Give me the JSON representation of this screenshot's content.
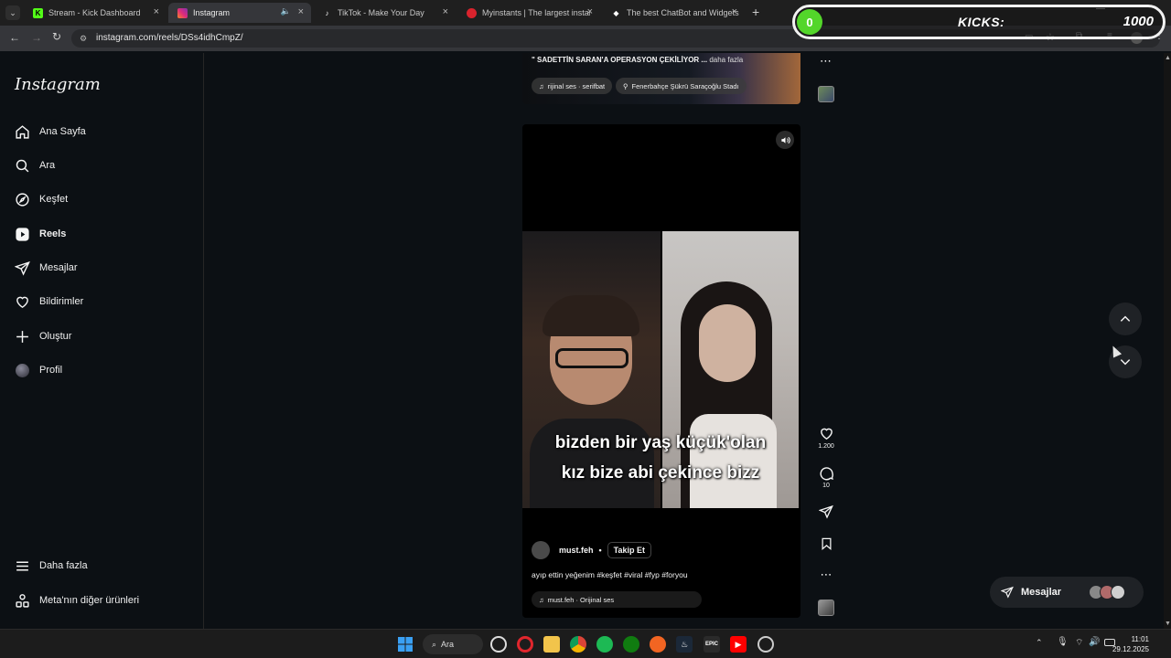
{
  "browser": {
    "tabs": [
      {
        "title": "Stream - Kick Dashboard",
        "icon": "kick-icon",
        "color": "#53fc18"
      },
      {
        "title": "Instagram",
        "icon": "instagram-icon",
        "color": "#e1306c",
        "active": true
      },
      {
        "title": "TikTok - Make Your Day",
        "icon": "tiktok-icon",
        "color": "#ffffff"
      },
      {
        "title": "Myinstants | The largest instant",
        "icon": "myinstants-icon",
        "color": "#d9232d"
      },
      {
        "title": "The best ChatBot and Widgets",
        "icon": "chatbot-icon",
        "color": "#ffffff"
      }
    ],
    "url": "instagram.com/reels/DSs4idhCmpZ/"
  },
  "kicks_overlay": {
    "badge": "0",
    "label": "KICKS:",
    "value": "1000"
  },
  "sidebar": {
    "logo": "Instagram",
    "items": [
      {
        "label": "Ana Sayfa",
        "icon": "home-icon"
      },
      {
        "label": "Ara",
        "icon": "search-icon"
      },
      {
        "label": "Keşfet",
        "icon": "compass-icon"
      },
      {
        "label": "Reels",
        "icon": "reels-icon",
        "active": true
      },
      {
        "label": "Mesajlar",
        "icon": "send-icon"
      },
      {
        "label": "Bildirimler",
        "icon": "heart-icon"
      },
      {
        "label": "Oluştur",
        "icon": "plus-icon"
      },
      {
        "label": "Profil",
        "icon": "avatar-icon"
      }
    ],
    "bottom": [
      {
        "label": "Daha fazla",
        "icon": "menu-icon"
      },
      {
        "label": "Meta'nın diğer ürünleri",
        "icon": "apps-icon"
      }
    ]
  },
  "prev_post": {
    "caption": "\" SADETTİN SARAN'A OPERASYON ÇEKİLİYOR ...",
    "more": "daha fazla",
    "audio": "rijinal ses · serifbat",
    "location": "Fenerbahçe Şükrü Saraçoğlu Stadı"
  },
  "post": {
    "caption_line1": "bizden bir yaş küçük'olan",
    "caption_line2": "kız bize abi çekince bizz",
    "username": "must.feh",
    "follow": "Takip Et",
    "description": "ayıp ettin yeğenim #keşfet #viral #fyp #foryou",
    "audio": "must.feh · Orijinal ses",
    "likes": "1.200",
    "comments": "10"
  },
  "messages_pill": {
    "label": "Mesajlar"
  },
  "taskbar": {
    "search": "Ara",
    "time": "11:01",
    "date": "29.12.2025"
  }
}
